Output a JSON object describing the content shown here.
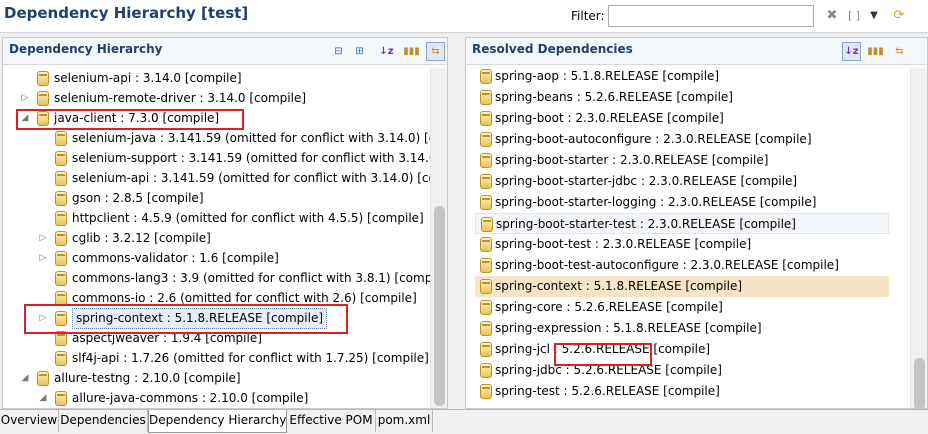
{
  "header": {
    "title": "Dependency Hierarchy [test]",
    "filter_label": "Filter:",
    "filter_value": "",
    "icons": [
      "clear-icon",
      "bracket-icon",
      "dropdown-icon",
      "refresh-icon"
    ]
  },
  "left_panel": {
    "title": "Dependency Hierarchy",
    "toolbar": [
      "collapse-all-icon",
      "expand-all-icon",
      "sort-az-icon",
      "show-groupid-icon",
      "link-editor-icon"
    ],
    "rows": [
      {
        "label": "selenium-api : 3.14.0 [compile]",
        "level": 0,
        "expander": ""
      },
      {
        "label": "selenium-remote-driver : 3.14.0 [compile]",
        "level": 0,
        "expander": "▷"
      },
      {
        "label": "java-client : 7.3.0 [compile]",
        "level": 0,
        "expander": "◢"
      },
      {
        "label": "selenium-java : 3.141.59 (omitted for conflict with 3.14.0) [con",
        "level": 1,
        "expander": ""
      },
      {
        "label": "selenium-support : 3.141.59 (omitted for conflict with 3.14.0) [",
        "level": 1,
        "expander": ""
      },
      {
        "label": "selenium-api : 3.141.59 (omitted for conflict with 3.14.0) [com",
        "level": 1,
        "expander": ""
      },
      {
        "label": "gson : 2.8.5 [compile]",
        "level": 1,
        "expander": ""
      },
      {
        "label": "httpclient : 4.5.9 (omitted for conflict with 4.5.5) [compile]",
        "level": 1,
        "expander": ""
      },
      {
        "label": "cglib : 3.2.12 [compile]",
        "level": 1,
        "expander": "▷"
      },
      {
        "label": "commons-validator : 1.6 [compile]",
        "level": 1,
        "expander": "▷"
      },
      {
        "label": "commons-lang3 : 3.9 (omitted for conflict with 3.8.1) [compile",
        "level": 1,
        "expander": ""
      },
      {
        "label": "commons-io : 2.6 (omitted for conflict with 2.6) [compile]",
        "level": 1,
        "expander": ""
      },
      {
        "label": "spring-context : 5.1.8.RELEASE [compile]",
        "level": 1,
        "expander": "▷"
      },
      {
        "label": "aspectjweaver : 1.9.4 [compile]",
        "level": 1,
        "expander": ""
      },
      {
        "label": "slf4j-api : 1.7.26 (omitted for conflict with 1.7.25) [compile]",
        "level": 1,
        "expander": ""
      },
      {
        "label": "allure-testng : 2.10.0 [compile]",
        "level": 0,
        "expander": "◢"
      },
      {
        "label": "allure-java-commons : 2.10.0 [compile]",
        "level": 1,
        "expander": "◢"
      }
    ]
  },
  "right_panel": {
    "title": "Resolved Dependencies",
    "toolbar": [
      "sort-az-icon",
      "show-groupid-icon",
      "link-editor-icon"
    ],
    "rows": [
      "spring-aop : 5.1.8.RELEASE [compile]",
      "spring-beans : 5.2.6.RELEASE [compile]",
      "spring-boot : 2.3.0.RELEASE [compile]",
      "spring-boot-autoconfigure : 2.3.0.RELEASE [compile]",
      "spring-boot-starter : 2.3.0.RELEASE [compile]",
      "spring-boot-starter-jdbc : 2.3.0.RELEASE [compile]",
      "spring-boot-starter-logging : 2.3.0.RELEASE [compile]",
      "spring-boot-starter-test : 2.3.0.RELEASE [compile]",
      "spring-boot-test : 2.3.0.RELEASE [compile]",
      "spring-boot-test-autoconfigure : 2.3.0.RELEASE [compile]",
      "spring-context : 5.1.8.RELEASE [compile]",
      "spring-core : 5.2.6.RELEASE [compile]",
      "spring-expression : 5.1.8.RELEASE [compile]",
      "spring-jcl : 5.2.6.RELEASE [compile]",
      "spring-jdbc : 5.2.6.RELEASE [compile]",
      "spring-test : 5.2.6.RELEASE [compile]"
    ]
  },
  "tabs": [
    "Overview",
    "Dependencies",
    "Dependency Hierarchy",
    "Effective POM",
    "pom.xml"
  ],
  "active_tab": "Dependency Hierarchy",
  "colors": {
    "title": "#203f6e",
    "highlight_box": "#e02020",
    "selection": "#f5e5c6"
  }
}
